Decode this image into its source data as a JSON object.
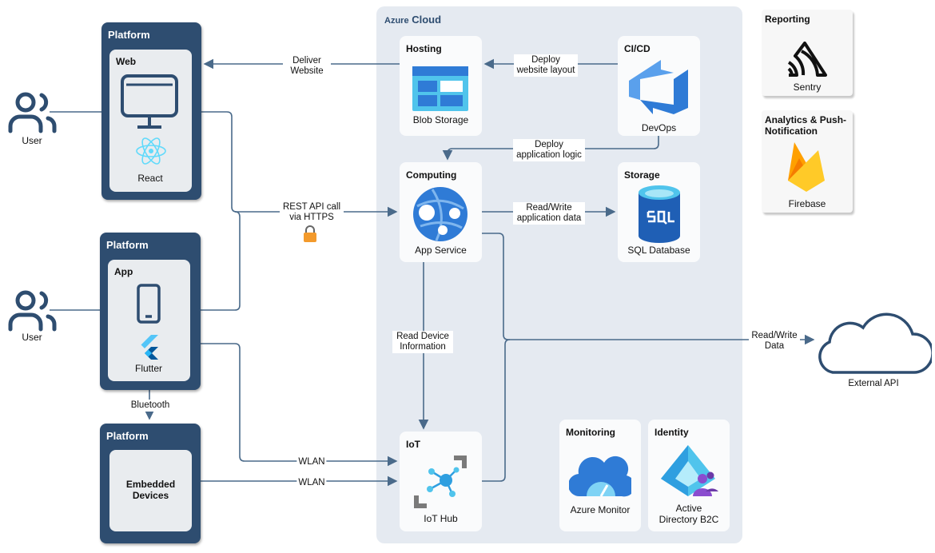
{
  "users": [
    {
      "label": "User"
    },
    {
      "label": "User"
    }
  ],
  "platforms": [
    {
      "title": "Platform",
      "inner_title": "Web",
      "tech": "React"
    },
    {
      "title": "Platform",
      "inner_title": "App",
      "tech": "Flutter"
    },
    {
      "title": "Platform",
      "inner_title": "Embedded Devices"
    }
  ],
  "cloud": {
    "title_a": "Azure",
    "title_b": "Cloud",
    "services": {
      "hosting": {
        "title": "Hosting",
        "caption": "Blob Storage"
      },
      "cicd": {
        "title": "CI/CD",
        "caption": "DevOps"
      },
      "computing": {
        "title": "Computing",
        "caption": "App Service"
      },
      "storage": {
        "title": "Storage",
        "caption": "SQL Database"
      },
      "iot": {
        "title": "IoT",
        "caption": "IoT Hub"
      },
      "monitoring": {
        "title": "Monitoring",
        "caption": "Azure Monitor"
      },
      "identity": {
        "title": "Identity",
        "caption": "Active Directory B2C"
      }
    }
  },
  "side": {
    "reporting": {
      "title": "Reporting",
      "caption": "Sentry"
    },
    "analytics": {
      "title": "Analytics & Push-Notification",
      "caption": "Firebase"
    }
  },
  "external": {
    "caption": "External API"
  },
  "connections": {
    "deliver": "Deliver Website",
    "deploy_layout": "Deploy website layout",
    "deploy_logic": "Deploy application logic",
    "rest": "REST API call via HTTPS",
    "rw_app": "Read/Write application data",
    "read_device": "Read Device Information",
    "rw_data": "Read/Write Data",
    "bluetooth": "Bluetooth",
    "wlan1": "WLAN",
    "wlan2": "WLAN"
  },
  "colors": {
    "platform": "#2e4d70",
    "cloud_bg": "#e5eaf1",
    "wire": "#4a6a8a",
    "azure": "#2f7bd6"
  }
}
